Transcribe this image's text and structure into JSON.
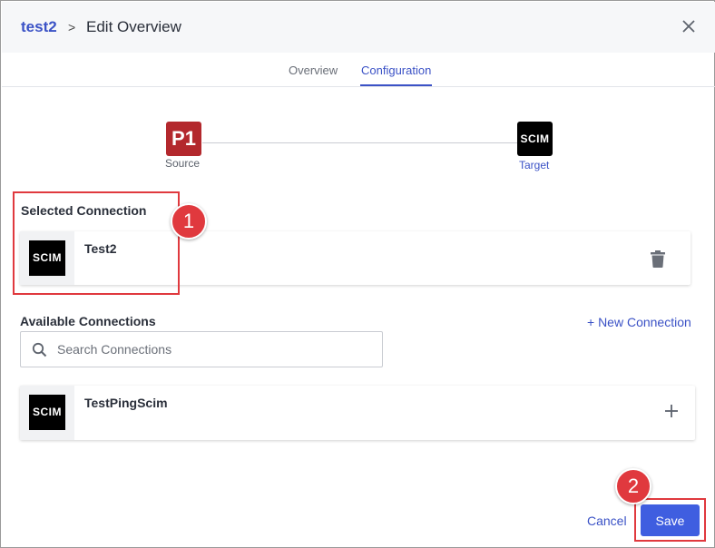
{
  "header": {
    "app_name": "test2",
    "separator": ">",
    "page_title": "Edit Overview"
  },
  "tabs": [
    {
      "label": "Overview",
      "active": false
    },
    {
      "label": "Configuration",
      "active": true
    }
  ],
  "flow": {
    "source_logo": "P1",
    "source_label": "Source",
    "target_logo": "SCIM",
    "target_label": "Target"
  },
  "selected": {
    "heading": "Selected Connection",
    "connection": {
      "logo": "SCIM",
      "name": "Test2"
    }
  },
  "available": {
    "heading": "Available Connections",
    "new_connection_label": "+ New Connection",
    "search_placeholder": "Search Connections",
    "connections": [
      {
        "logo": "SCIM",
        "name": "TestPingScim"
      }
    ]
  },
  "footer": {
    "cancel_label": "Cancel",
    "save_label": "Save"
  },
  "annotations": {
    "step1": "1",
    "step2": "2"
  },
  "colors": {
    "accent": "#3b52c6",
    "save_button": "#3f5ee0",
    "annotation": "#e0393e",
    "p1_brand": "#b3282d"
  }
}
